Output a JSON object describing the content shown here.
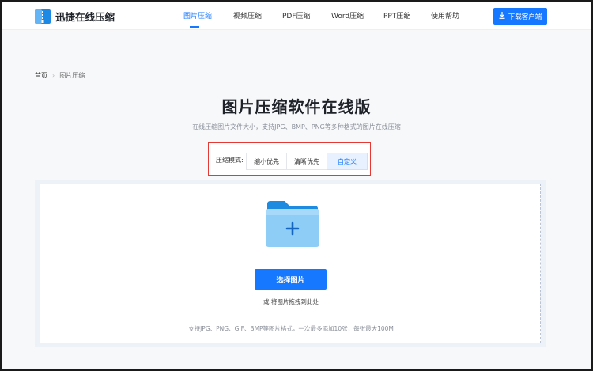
{
  "header": {
    "logo_text": "迅捷在线压缩",
    "nav": [
      {
        "label": "图片压缩",
        "active": true
      },
      {
        "label": "视频压缩",
        "active": false
      },
      {
        "label": "PDF压缩",
        "active": false
      },
      {
        "label": "Word压缩",
        "active": false
      },
      {
        "label": "PPT压缩",
        "active": false
      },
      {
        "label": "使用帮助",
        "active": false
      }
    ],
    "download_label": "下载客户端"
  },
  "breadcrumb": {
    "home": "首页",
    "separator": "›",
    "current": "图片压缩"
  },
  "page": {
    "title": "图片压缩软件在线版",
    "subtitle": "在线压缩图片文件大小，支持JPG、BMP、PNG等多种格式的图片在线压缩"
  },
  "mode": {
    "label": "压缩模式:",
    "options": [
      "缩小优先",
      "清晰优先",
      "自定义"
    ],
    "selected": "自定义"
  },
  "upload": {
    "choose_label": "选择图片",
    "drag_hint": "或 将图片拖拽到此处",
    "formats_hint": "支持JPG、PNG、GIF、BMP等图片格式，一次最多添加10张，每张最大100M"
  },
  "colors": {
    "accent": "#1677ff",
    "highlight_border": "#e53935",
    "folder_back": "#1f8be0",
    "folder_front": "#8ecdf6"
  },
  "icons": {
    "logo": "zip-folder-icon",
    "download": "download-icon",
    "folder": "folder-add-icon"
  }
}
